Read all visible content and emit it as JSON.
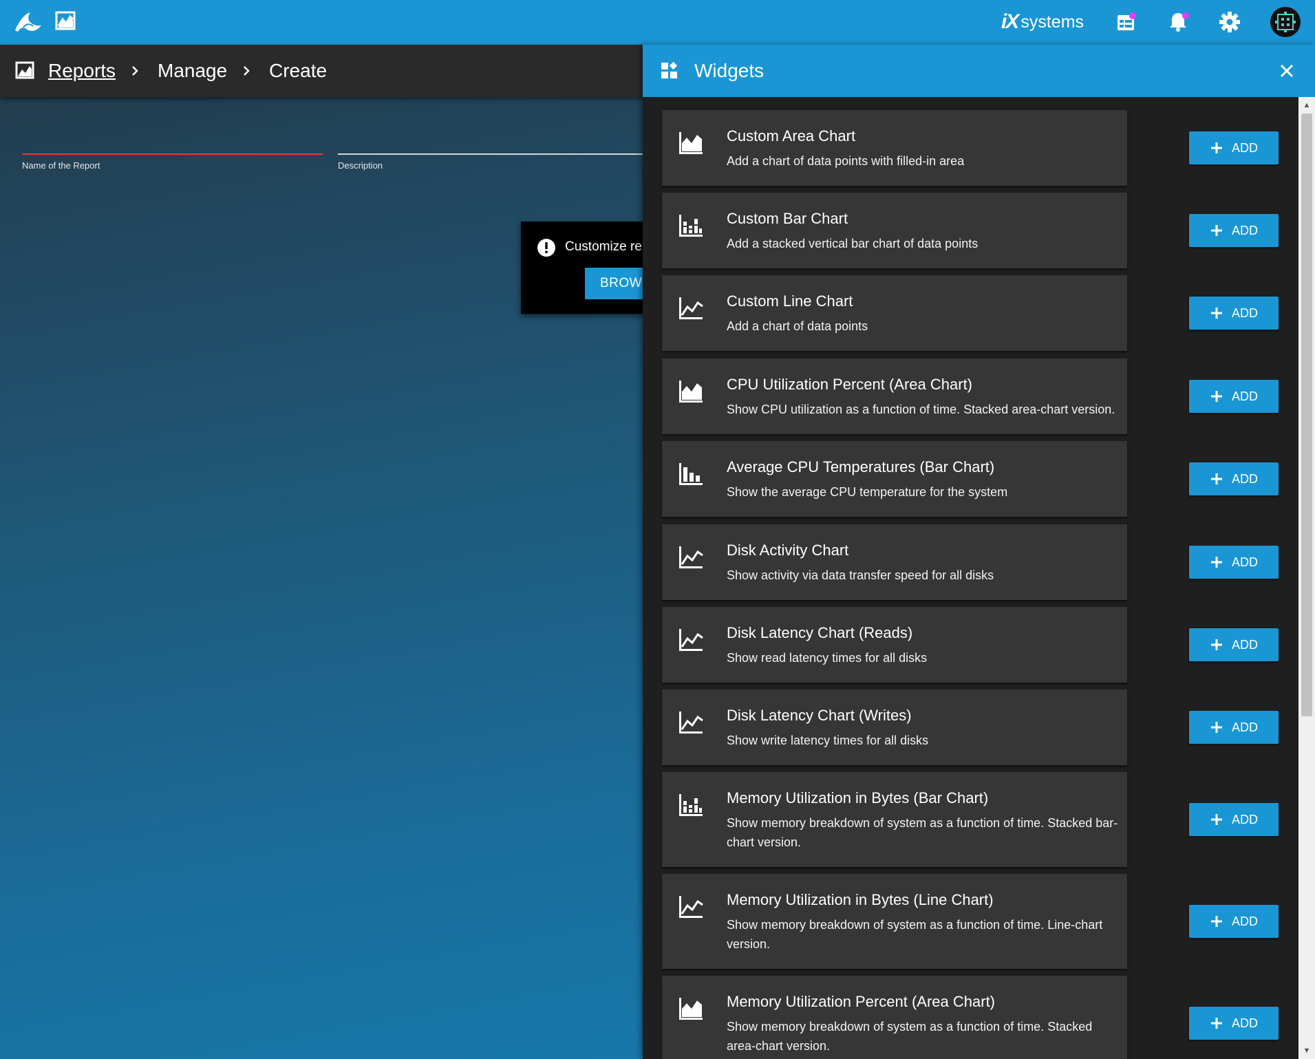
{
  "topbar": {
    "brand_prefix": "iX",
    "brand_suffix": "systems",
    "icons": [
      "freenas-logo-icon",
      "reports-chart-icon",
      "calendar-tasks-icon",
      "bell-icon",
      "gear-icon",
      "avatar-icon"
    ],
    "notification_dot_color": "#e040fb"
  },
  "breadcrumb": {
    "items": [
      "Reports",
      "Manage",
      "Create"
    ],
    "icon": "reports-chart-icon"
  },
  "form": {
    "name_label": "Name of the Report",
    "description_label": "Description"
  },
  "toast": {
    "text": "Customize re",
    "button_label": "BROWS"
  },
  "panel": {
    "title": "Widgets",
    "add_label": "ADD",
    "widgets": [
      {
        "icon": "area-chart-icon",
        "title": "Custom Area Chart",
        "description": "Add a chart of data points with filled-in area"
      },
      {
        "icon": "stacked-bar-chart-icon",
        "title": "Custom Bar Chart",
        "description": "Add a stacked vertical bar chart of data points"
      },
      {
        "icon": "line-chart-icon",
        "title": "Custom Line Chart",
        "description": "Add a chart of data points"
      },
      {
        "icon": "area-chart-icon",
        "title": "CPU Utilization Percent (Area Chart)",
        "description": "Show CPU utilization as a function of time. Stacked area-chart version."
      },
      {
        "icon": "bar-chart-icon",
        "title": "Average CPU Temperatures (Bar Chart)",
        "description": "Show the average CPU temperature for the system"
      },
      {
        "icon": "line-chart-icon",
        "title": "Disk Activity Chart",
        "description": "Show activity via data transfer speed for all disks"
      },
      {
        "icon": "line-chart-icon",
        "title": "Disk Latency Chart (Reads)",
        "description": "Show read latency times for all disks"
      },
      {
        "icon": "line-chart-icon",
        "title": "Disk Latency Chart (Writes)",
        "description": "Show write latency times for all disks"
      },
      {
        "icon": "stacked-bar-chart-icon",
        "title": "Memory Utilization in Bytes (Bar Chart)",
        "description": "Show memory breakdown of system as a function of time. Stacked bar-chart version."
      },
      {
        "icon": "line-chart-icon",
        "title": "Memory Utilization in Bytes (Line Chart)",
        "description": "Show memory breakdown of system as a function of time. Line-chart version."
      },
      {
        "icon": "area-chart-icon",
        "title": "Memory Utilization Percent (Area Chart)",
        "description": "Show memory breakdown of system as a function of time. Stacked area-chart version."
      }
    ]
  },
  "colors": {
    "accent": "#1a96d5",
    "error_underline": "#e53935",
    "card": "#363636",
    "breadcrumb_bar": "#2a2a2a"
  }
}
